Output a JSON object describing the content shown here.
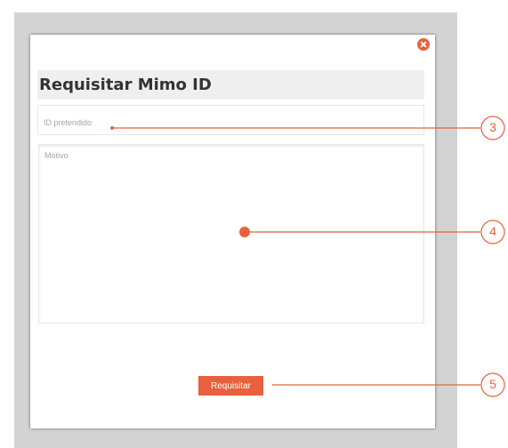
{
  "dialog": {
    "title": "Requisitar Mimo ID",
    "close_icon": "close-circle-icon",
    "id_field": {
      "placeholder": "ID pretendido"
    },
    "reason_field": {
      "placeholder": "Motivo"
    },
    "submit_label": "Requisitar"
  },
  "callouts": [
    {
      "number": "3"
    },
    {
      "number": "4"
    },
    {
      "number": "5"
    }
  ],
  "colors": {
    "accent": "#e8603c",
    "backdrop": "#d3d3d3",
    "title_bar": "#efefef",
    "placeholder_text": "#a5a5a5"
  }
}
